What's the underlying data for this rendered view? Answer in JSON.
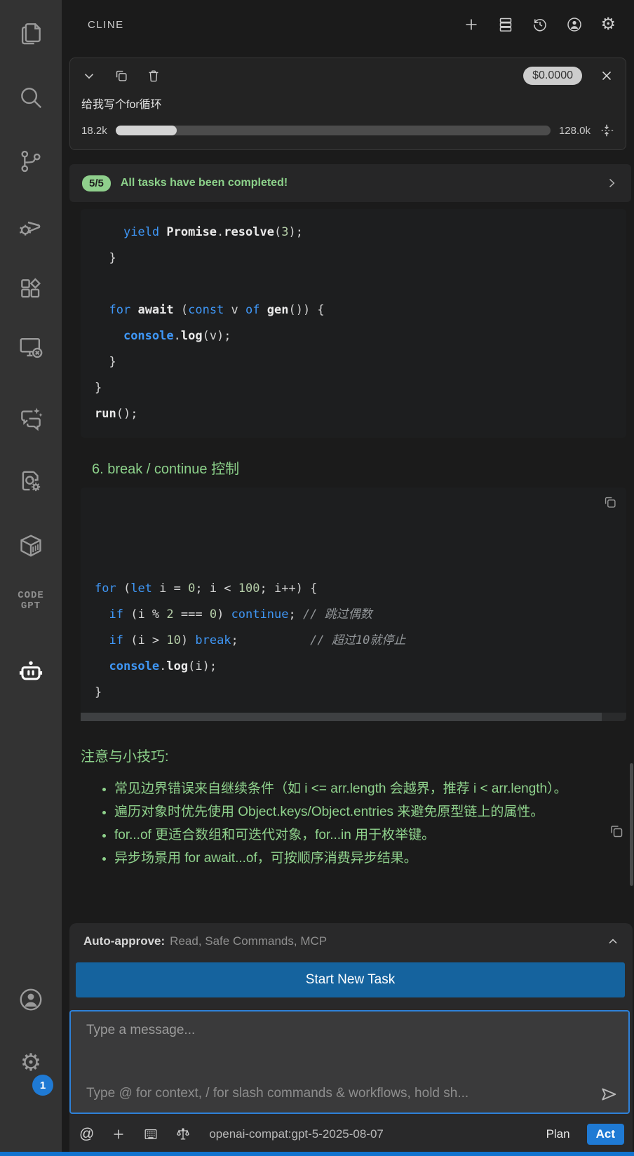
{
  "colors": {
    "accent_blue": "#1f7ad4",
    "button_blue": "#15639e",
    "input_border_blue": "#2e81d8",
    "success_green": "#8cd18a",
    "keyword_blue": "#3f97f6",
    "number_green": "#b5cea8",
    "sidebar_bg": "#333333",
    "panel_bg": "#1b1b1b",
    "code_bg": "#1d1e1f"
  },
  "activity_bar": {
    "icons": [
      "explorer-icon",
      "search-icon",
      "source-control-icon",
      "run-debug-icon",
      "extensions-icon",
      "remote-explorer-icon",
      "chat-sparkle-icon",
      "cpp-tools-icon",
      "container-icon",
      "codegpt-logo",
      "cline-robot-icon",
      "account-icon",
      "settings-gear-icon"
    ],
    "codegpt_line1": "CODE",
    "codegpt_line2": "GPT",
    "settings_badge": "1"
  },
  "header": {
    "title": "CLINE",
    "icons": [
      "plus-icon",
      "mcp-servers-icon",
      "history-icon",
      "account-icon",
      "settings-gear-icon"
    ]
  },
  "task": {
    "prompt": "给我写个for循环",
    "cost": "$0.0000",
    "context_used": "18.2k",
    "context_max": "128.0k",
    "progress_pct": 14
  },
  "banner": {
    "badge": "5/5",
    "text": "All tasks have been completed!"
  },
  "message": {
    "heading": "6. break / continue 控制",
    "tips_title": "注意与小技巧:",
    "tips": [
      "常见边界错误来自继续条件（如 i <= arr.length 会越界，推荐 i < arr.length）。",
      "遍历对象时优先使用 Object.keys/Object.entries 来避免原型链上的属性。",
      "for...of 更适合数组和可迭代对象，for...in 用于枚举键。",
      "异步场景用 for await...of，可按顺序消费异步结果。"
    ]
  },
  "code_blocks": [
    {
      "language": "javascript",
      "lines": [
        [
          [
            "    ",
            "p"
          ],
          [
            "yield",
            "k"
          ],
          [
            " ",
            "p"
          ],
          [
            "Promise",
            "b"
          ],
          [
            ".",
            "p"
          ],
          [
            "resolve",
            "b"
          ],
          [
            "(",
            "p"
          ],
          [
            "3",
            "n"
          ],
          [
            ");",
            "p"
          ]
        ],
        [
          [
            "  }",
            "p"
          ]
        ],
        [
          [
            " ",
            "p"
          ]
        ],
        [
          [
            "  ",
            "p"
          ],
          [
            "for",
            "k"
          ],
          [
            " ",
            "p"
          ],
          [
            "await",
            "b"
          ],
          [
            " (",
            "p"
          ],
          [
            "const",
            "k"
          ],
          [
            " v ",
            "p"
          ],
          [
            "of",
            "k"
          ],
          [
            " ",
            "p"
          ],
          [
            "gen",
            "b"
          ],
          [
            "()) {",
            "p"
          ]
        ],
        [
          [
            "    ",
            "p"
          ],
          [
            "console",
            "kb"
          ],
          [
            ".",
            "p"
          ],
          [
            "log",
            "b"
          ],
          [
            "(v);",
            "p"
          ]
        ],
        [
          [
            "  }",
            "p"
          ]
        ],
        [
          [
            "}",
            "p"
          ]
        ],
        [
          [
            "run",
            "b"
          ],
          [
            "();",
            "p"
          ]
        ]
      ]
    },
    {
      "language": "javascript",
      "lines": [
        [
          [
            "for",
            "k"
          ],
          [
            " (",
            "p"
          ],
          [
            "let",
            "k"
          ],
          [
            " i = ",
            "p"
          ],
          [
            "0",
            "n"
          ],
          [
            "; i < ",
            "p"
          ],
          [
            "100",
            "n"
          ],
          [
            "; i++) {",
            "p"
          ]
        ],
        [
          [
            "  ",
            "p"
          ],
          [
            "if",
            "k"
          ],
          [
            " (i % ",
            "p"
          ],
          [
            "2",
            "n"
          ],
          [
            " === ",
            "p"
          ],
          [
            "0",
            "n"
          ],
          [
            ") ",
            "p"
          ],
          [
            "continue",
            "k"
          ],
          [
            "; ",
            "p"
          ],
          [
            "// 跳过偶数",
            "c"
          ]
        ],
        [
          [
            "  ",
            "p"
          ],
          [
            "if",
            "k"
          ],
          [
            " (i > ",
            "p"
          ],
          [
            "10",
            "n"
          ],
          [
            ") ",
            "p"
          ],
          [
            "break",
            "k"
          ],
          [
            ";          ",
            "p"
          ],
          [
            "// 超过10就停止",
            "c"
          ]
        ],
        [
          [
            "  ",
            "p"
          ],
          [
            "console",
            "kb"
          ],
          [
            ".",
            "p"
          ],
          [
            "log",
            "b"
          ],
          [
            "(i);",
            "p"
          ]
        ],
        [
          [
            "}",
            "p"
          ]
        ]
      ]
    }
  ],
  "autoapprove": {
    "label": "Auto-approve:",
    "value": "Read, Safe Commands, MCP"
  },
  "actions": {
    "start_new_task": "Start New Task"
  },
  "composer": {
    "placeholder_top": "Type a message...",
    "placeholder_bottom": "Type @ for context, / for slash commands & workflows, hold sh..."
  },
  "statusbar": {
    "model": "openai-compat:gpt-5-2025-08-07",
    "plan_label": "Plan",
    "act_label": "Act"
  }
}
